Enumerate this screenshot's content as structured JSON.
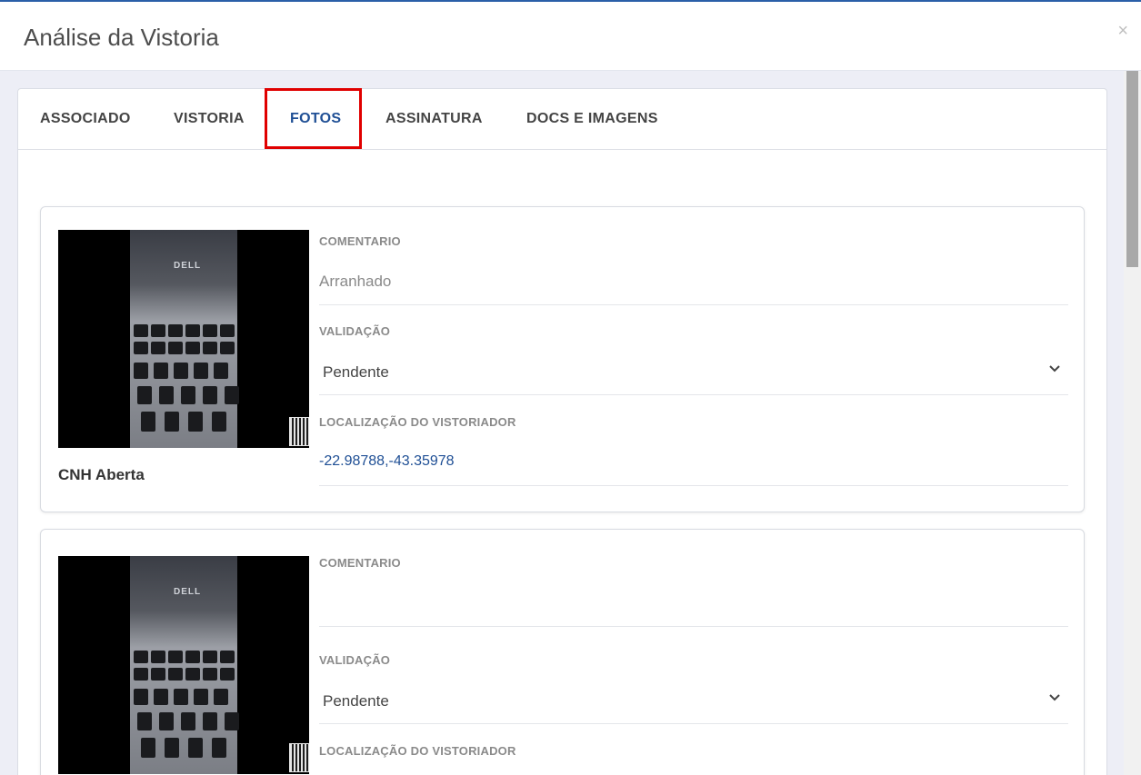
{
  "modal": {
    "title": "Análise da Vistoria",
    "close_label": "×"
  },
  "tabs": [
    {
      "label": "ASSOCIADO"
    },
    {
      "label": "VISTORIA"
    },
    {
      "label": "FOTOS",
      "active": true
    },
    {
      "label": "ASSINATURA"
    },
    {
      "label": "DOCS E IMAGENS"
    }
  ],
  "cards": [
    {
      "caption": "CNH Aberta",
      "photo_brand": "DELL",
      "comment_label": "COMENTARIO",
      "comment_value": "Arranhado",
      "validation_label": "VALIDAÇÃO",
      "validation_value": "Pendente",
      "location_label": "LOCALIZAÇÃO DO VISTORIADOR",
      "location_value": "-22.98788,-43.35978"
    },
    {
      "caption": "",
      "photo_brand": "DELL",
      "comment_label": "COMENTARIO",
      "comment_value": "",
      "validation_label": "VALIDAÇÃO",
      "validation_value": "Pendente",
      "location_label": "LOCALIZAÇÃO DO VISTORIADOR",
      "location_value": ""
    }
  ],
  "colors": {
    "accent": "#1f4f95",
    "highlight": "#e00000",
    "body_bg": "#edeef6"
  }
}
